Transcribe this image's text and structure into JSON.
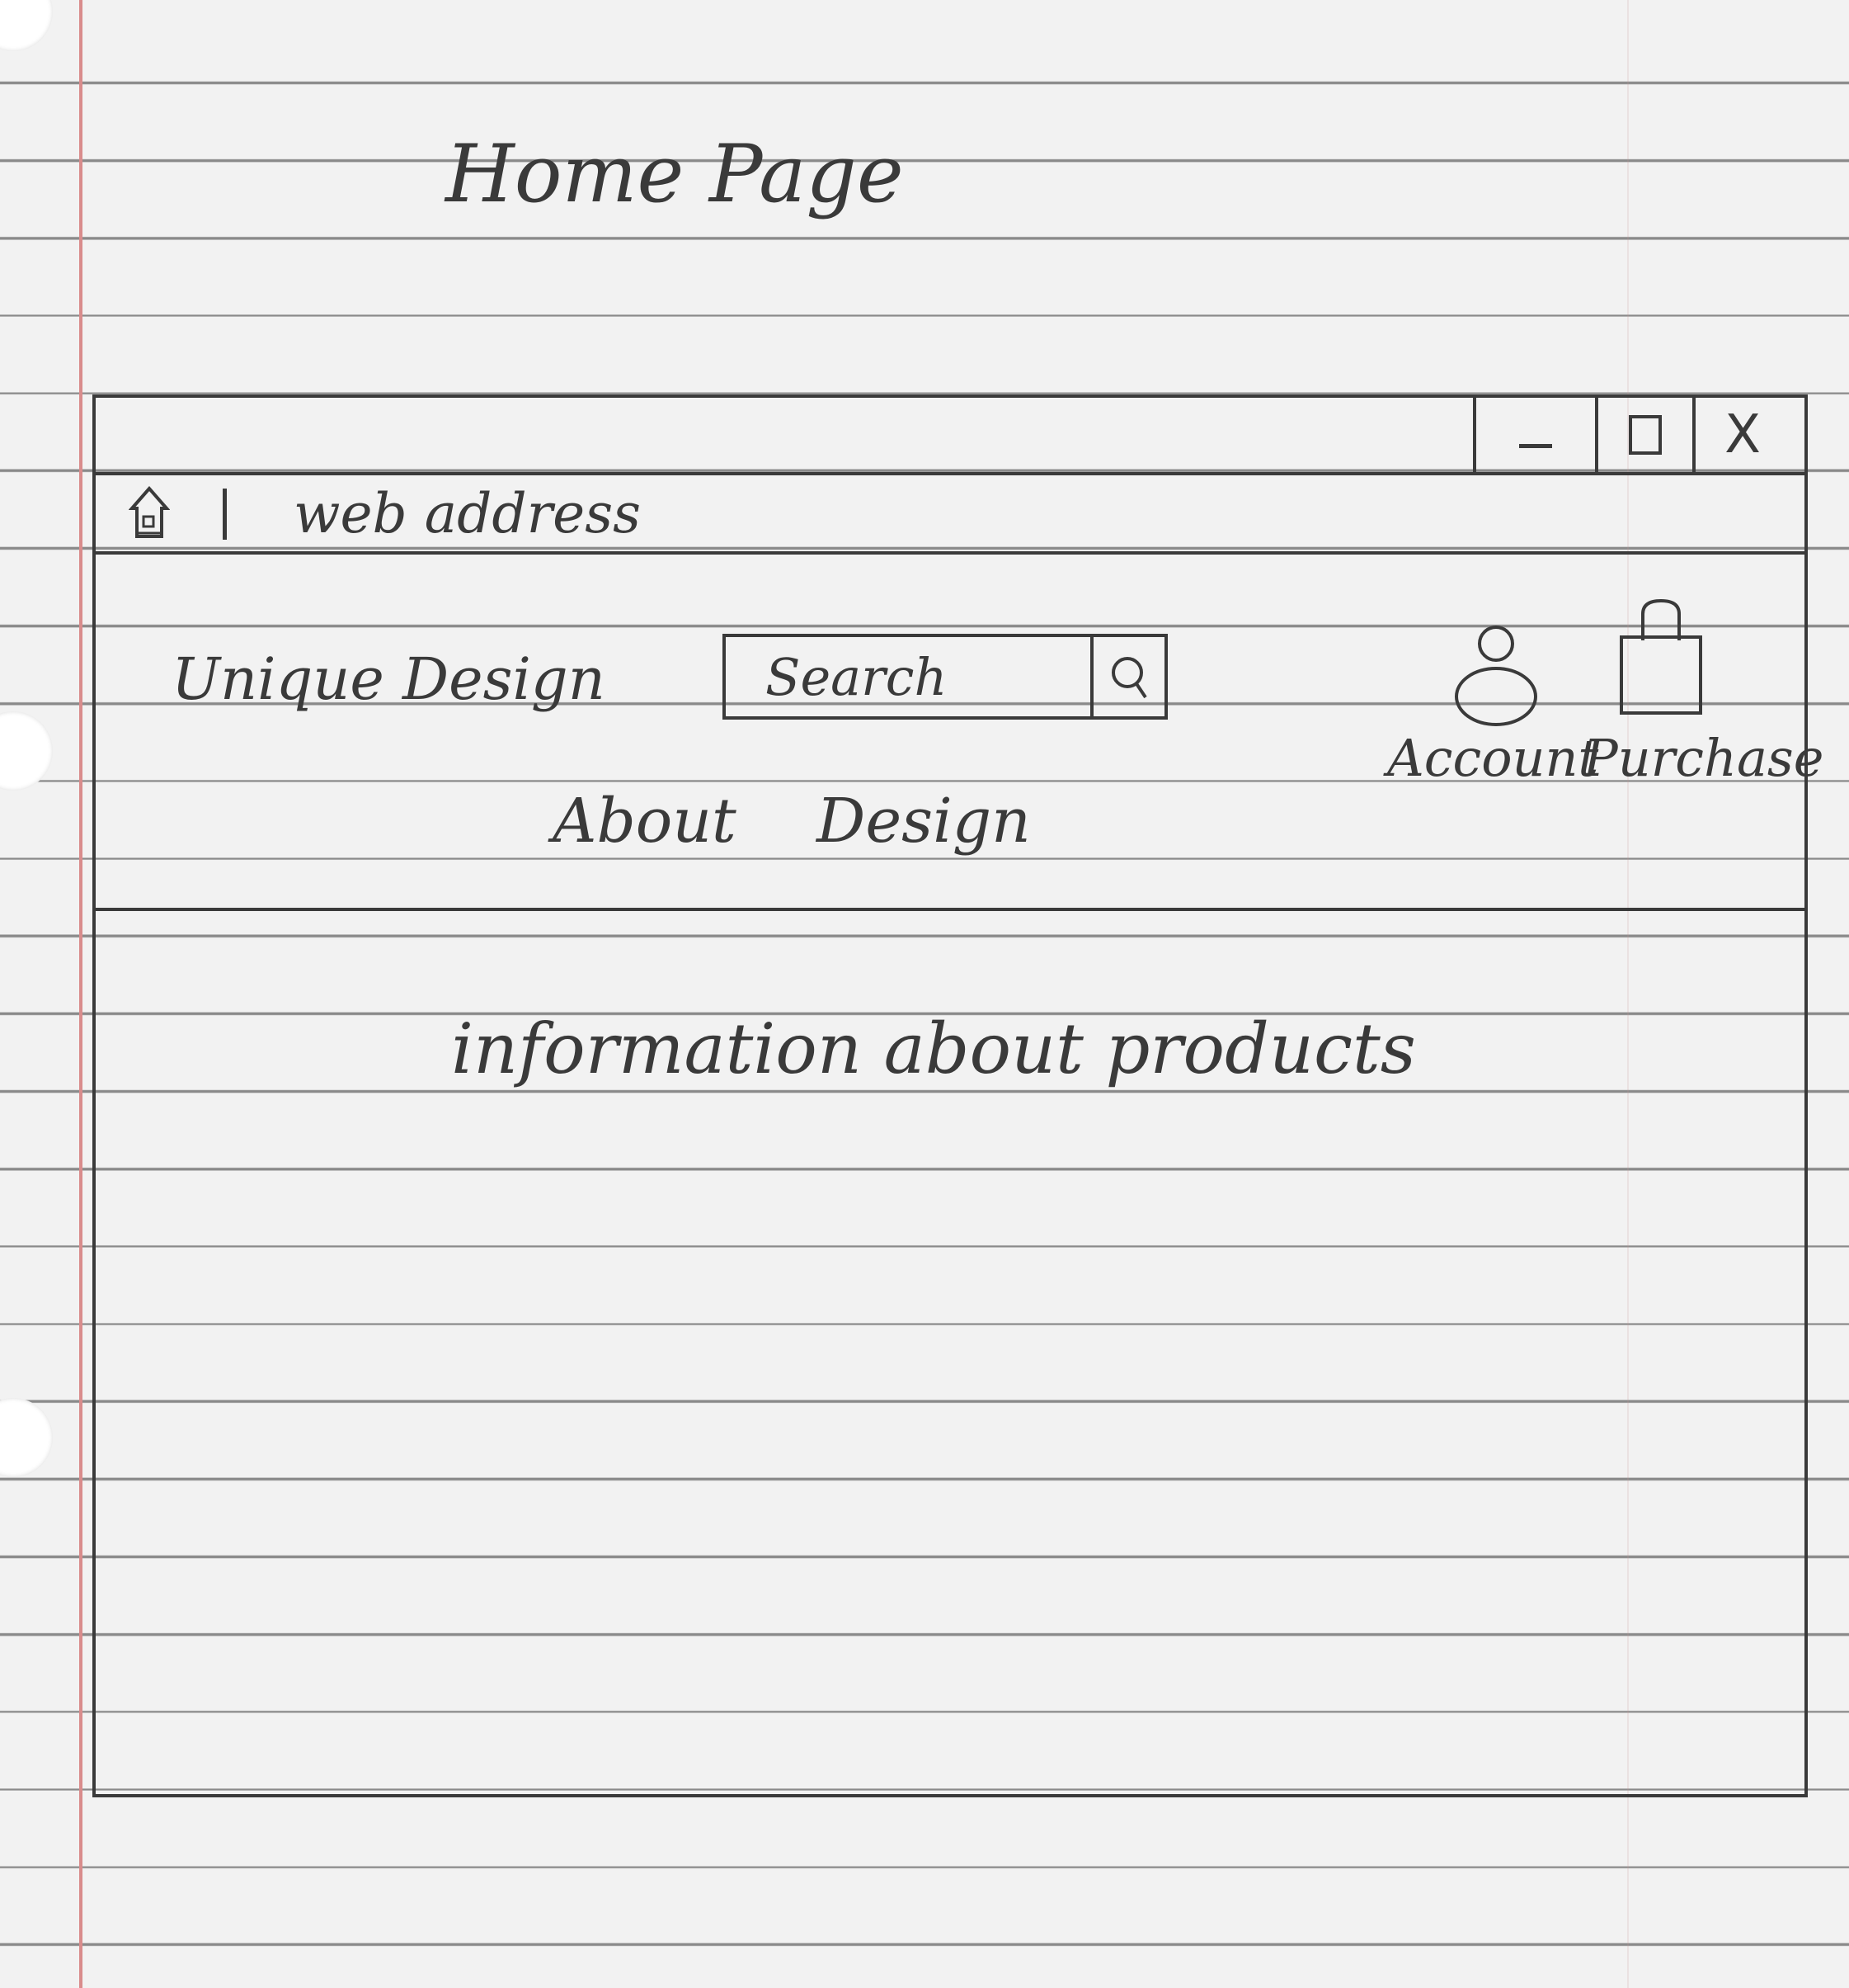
{
  "page": {
    "title": "Home Page"
  },
  "window": {
    "controls": {
      "minimize": "minimize",
      "maximize": "maximize",
      "close": "X"
    },
    "address_bar": {
      "home_icon": "home-icon",
      "text": "web address"
    }
  },
  "header": {
    "logo": "Unique Design",
    "search": {
      "placeholder": "Search",
      "icon": "search-icon"
    },
    "account": {
      "icon": "user-icon",
      "label": "Account"
    },
    "purchase": {
      "icon": "shopping-bag-icon",
      "label": "Purchase"
    },
    "nav": [
      {
        "label": "About"
      },
      {
        "label": "Design"
      }
    ]
  },
  "main": {
    "content": "information about products"
  },
  "colors": {
    "paper": "#f2f2f2",
    "rule_line": "#8a8a8a",
    "margin_line": "#d98c8c",
    "ink": "#3a3a3a"
  }
}
